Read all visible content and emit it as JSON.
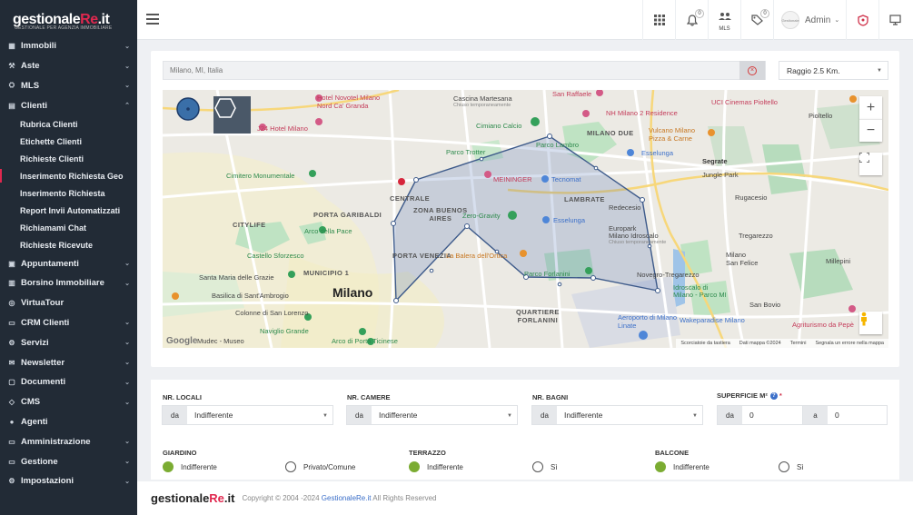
{
  "brand": {
    "name_part1": "gestionale",
    "name_part2": "Re",
    "name_part3": ".it",
    "tagline": "GESTIONALE PER AGENZIA IMMOBILIARE",
    "accent": "#e0284f"
  },
  "sidebar": {
    "items": [
      {
        "label": "Immobili",
        "icon": "building-icon",
        "chev": "⌄"
      },
      {
        "label": "Aste",
        "icon": "gavel-icon",
        "chev": "⌄"
      },
      {
        "label": "MLS",
        "icon": "handshake-icon",
        "chev": "⌄"
      },
      {
        "label": "Clienti",
        "icon": "clipboard-icon",
        "chev": "⌃"
      }
    ],
    "sub_items": [
      "Rubrica Clienti",
      "Etichette Clienti",
      "Richieste Clienti",
      "Inserimento Richiesta Geo",
      "Inserimento Richiesta",
      "Report Invii Automatizzati",
      "Richiamami Chat",
      "Richieste Ricevute"
    ],
    "items_after": [
      {
        "label": "Appuntamenti",
        "icon": "calendar-icon",
        "chev": "⌄"
      },
      {
        "label": "Borsino Immobiliare",
        "icon": "chart-icon",
        "chev": "⌄"
      },
      {
        "label": "VirtuaTour",
        "icon": "vr-icon",
        "chev": ""
      },
      {
        "label": "CRM Clienti",
        "icon": "crm-icon",
        "chev": "⌄"
      },
      {
        "label": "Servizi",
        "icon": "tools-icon",
        "chev": "⌄"
      },
      {
        "label": "Newsletter",
        "icon": "envelope-icon",
        "chev": "⌄"
      },
      {
        "label": "Documenti",
        "icon": "folder-icon",
        "chev": "⌄"
      },
      {
        "label": "CMS",
        "icon": "cms-icon",
        "chev": "⌄"
      },
      {
        "label": "Agenti",
        "icon": "user-icon",
        "chev": ""
      },
      {
        "label": "Amministrazione",
        "icon": "admin-icon",
        "chev": "⌄"
      },
      {
        "label": "Gestione",
        "icon": "gestione-icon",
        "chev": "⌄"
      },
      {
        "label": "Impostazioni",
        "icon": "gear-icon",
        "chev": "⌄"
      }
    ]
  },
  "topbar": {
    "notifications_count": "0",
    "mls_label": "MLS",
    "tags_count": "0",
    "admin_name": "Admin",
    "avatar_text": "Gestionale"
  },
  "search": {
    "placeholder": "Milano, MI, Italia",
    "radius": "Raggio 2.5 Km."
  },
  "map": {
    "labels": {
      "hotel_novotel": "Hotel Novotel Milano\nNord Ca' Granda",
      "cascina": "Cascina Martesana",
      "cascina_sub": "Chiuso temporaneamente",
      "san_raffaele": "San Raffaele",
      "uci": "UCI Cinemas Pioltello",
      "j24": "J24 Hotel Milano",
      "cimiano": "Cimiano Calcio",
      "nh": "NH Milano 2 Residence",
      "pioltello": "Pioltello",
      "milano_due": "MILANO DUE",
      "vulcano": "Vulcano Milano\nPizza & Carne",
      "parco_trotter": "Parco Trotter",
      "parco_lambro": "Parco Lambro",
      "esselunga1": "Esselunga",
      "cimitero": "Cimitero Monumentale",
      "meininger": "MEININGER",
      "tecnomat": "Tecnomat",
      "segrate": "Segrate",
      "jungle": "Jungle Park",
      "rugacesio": "Rugacesio",
      "centrale": "CENTRALE",
      "lambrate": "LAMBRATE",
      "redecesio": "Redecesio",
      "zona_buenos": "ZONA BUENOS\nAIRES",
      "porta_garibaldi": "PORTA GARIBALDI",
      "zero_gravity": "Zero-Gravity",
      "esselunga2": "Esselunga",
      "citylife": "CITYLIFE",
      "arco_pace": "Arco della Pace",
      "eurospark": "Europark\nMilano Idroscalo",
      "eurospark_sub": "Chiuso temporaneamente",
      "tregarezzo": "Tregarezzo",
      "castello": "Castello Sforzesco",
      "porta_venezia": "PORTA VENEZIA",
      "balera": "La Balera dell'Ortica",
      "milano_san_felice": "Milano\nSan Felice",
      "millepini": "Millepini",
      "municipio": "MUNICIPIO 1",
      "santa_maria": "Santa Maria delle Grazie",
      "parco_forlanini": "Parco Forlanini",
      "novegro": "Novegro-Tregarezzo",
      "basilica": "Basilica di Sant'Ambrogio",
      "milano": "Milano",
      "idroscalo": "Idroscalo di\nMilano - Parco MI",
      "san_bovio": "San Bovio",
      "colonne": "Colonne di San Lorenzo",
      "quartiere": "QUARTIERE\nFORLANINI",
      "aeroporto": "Aeroporto di Milano\nLinate",
      "wakeparadise": "Wakeparadise Milano",
      "agriturismo": "Agriturismo da Pepè",
      "mudec": "Mudec - Museo",
      "naviglio": "Naviglio Grande",
      "arco_ticinese": "Arco di Porta Ticinese"
    },
    "attribution": [
      "Scorciatoie da tastiera",
      "Dati mappa ©2024",
      "Termini",
      "Segnala un errore nella mappa"
    ],
    "google": "Google"
  },
  "filters": {
    "locali": {
      "label": "NR. LOCALI",
      "prefix": "da",
      "value": "Indifferente"
    },
    "camere": {
      "label": "NR. CAMERE",
      "prefix": "da",
      "value": "Indifferente"
    },
    "bagni": {
      "label": "NR. BAGNI",
      "prefix": "da",
      "value": "Indifferente"
    },
    "superficie": {
      "label": "SUPERFICIE M²",
      "required": "*",
      "help": "?",
      "from_prefix": "da",
      "from_value": "0",
      "to_prefix": "a",
      "to_value": "0"
    },
    "giardino": {
      "label": "GIARDINO",
      "opt1": "Indifferente",
      "opt2": "Privato/Comune"
    },
    "terrazzo": {
      "label": "TERRAZZO",
      "opt1": "Indifferente",
      "opt2": "Sì"
    },
    "balcone": {
      "label": "BALCONE",
      "opt1": "Indifferente",
      "opt2": "Sì"
    }
  },
  "footer": {
    "copyright": "Copyright © 2004 -2024 ",
    "link": "GestionaleRe.it",
    "rights": " All Rights Reserved"
  },
  "colors": {
    "sidebar_bg": "#222b36",
    "radio_on": "#7bac32",
    "polygon": "#4a6fb0"
  }
}
